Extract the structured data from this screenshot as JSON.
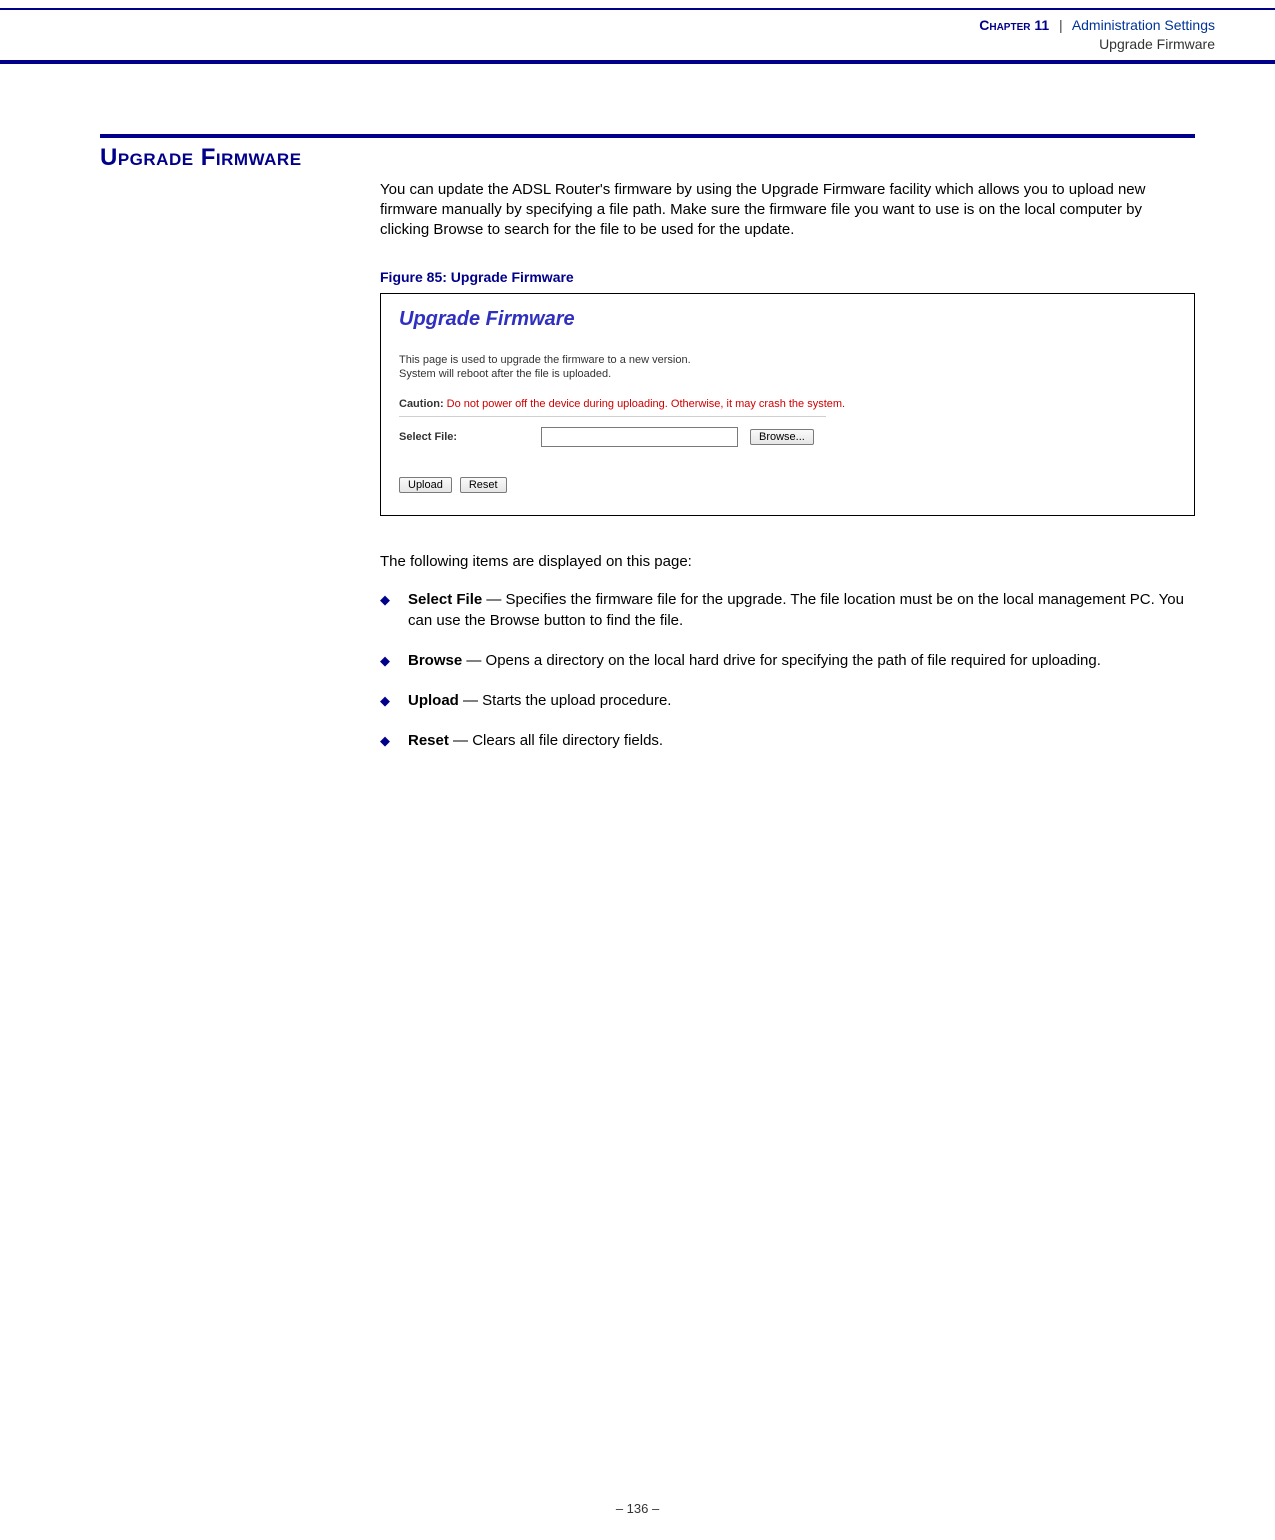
{
  "header": {
    "chapter_label": "Chapter 11",
    "separator": "|",
    "chapter_title": "Administration Settings",
    "chapter_subtitle": "Upgrade Firmware"
  },
  "section": {
    "heading": "Upgrade Firmware",
    "intro": "You can update the ADSL Router's firmware by using the Upgrade Firmware facility which allows you to upload new firmware manually by specifying a file path. Make sure the firmware file you want to use is on the local computer by clicking Browse to search for the file to be used for the update."
  },
  "figure": {
    "caption": "Figure 85:  Upgrade Firmware",
    "title": "Upgrade Firmware",
    "desc_line1": "This page is used to upgrade the firmware to a new version.",
    "desc_line2": "System will reboot after the file is uploaded.",
    "caution_label": "Caution:",
    "caution_text": " Do not power off the device during uploading. Otherwise, it may crash the system.",
    "select_file_label": "Select File:",
    "browse_button": "Browse...",
    "upload_button": "Upload",
    "reset_button": "Reset"
  },
  "following": {
    "intro": "The following items are displayed on this page:",
    "items": [
      {
        "label": "Select File",
        "desc": " — Specifies the firmware file for the upgrade. The file location must be on the local management PC. You can use the Browse button to find the file."
      },
      {
        "label": "Browse",
        "desc": " — Opens a directory on the local hard drive for specifying the path of file required for uploading."
      },
      {
        "label": "Upload",
        "desc": " — Starts the upload procedure."
      },
      {
        "label": "Reset",
        "desc": " — Clears all file directory fields."
      }
    ]
  },
  "footer": {
    "page": "–  136  –"
  }
}
